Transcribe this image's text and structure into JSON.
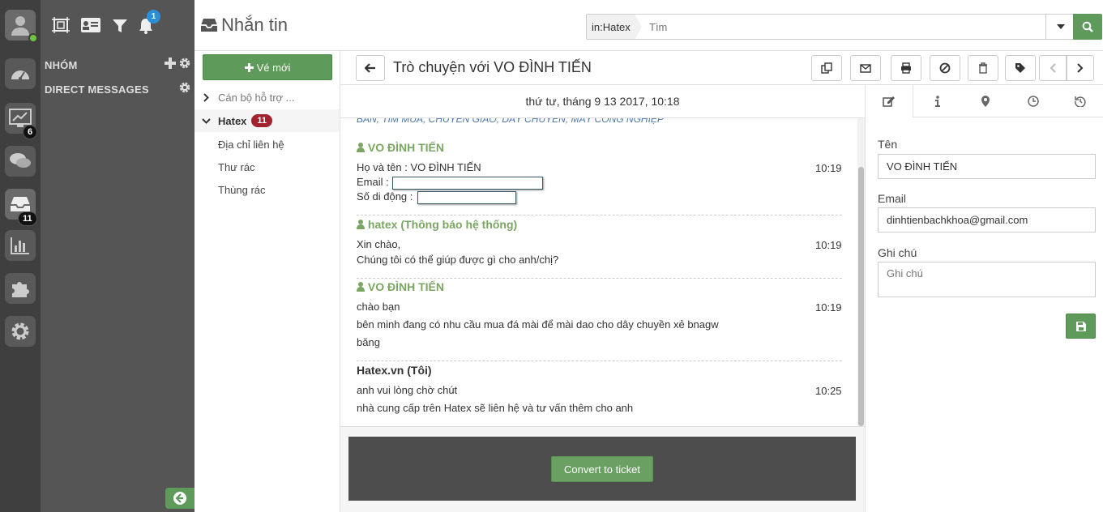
{
  "rail": {
    "badges": {
      "activity": "6",
      "inbox": "11"
    }
  },
  "sidebar": {
    "notification_count": "1",
    "groups_label": "NHÓM",
    "dm_label": "DIRECT MESSAGES"
  },
  "header": {
    "title": "Nhắn tin",
    "search_scope": "in:Hatex",
    "search_placeholder": "Tìm"
  },
  "folders": {
    "new_ticket_label": "Vé mới",
    "items": [
      {
        "label": "Cán bộ hỗ trợ ..."
      },
      {
        "label": "Hatex",
        "count": "11"
      },
      {
        "label": "Địa chỉ liên hệ"
      },
      {
        "label": "Thư rác"
      },
      {
        "label": "Thùng rác"
      }
    ]
  },
  "conversation": {
    "title": "Trò chuyện với VO ĐÌNH TIẾN",
    "date": "thứ tư, tháng 9 13 2017, 10:18",
    "cut_text": "BÁN, TÌM MUA, CHUYỂN GIAO, DÂY CHUYỀN, MÁY CÔNG NGHIỆP",
    "messages": [
      {
        "author": "VO ĐÌNH TIẾN",
        "time": "10:19",
        "lines": [
          "Họ và tên : VO ĐÌNH TIẾN",
          "Email :",
          "Số di động :"
        ]
      },
      {
        "author": "hatex (Thông báo hệ thống)",
        "time": "10:19",
        "lines": [
          "Xin chào,",
          "Chúng tôi có thể giúp được gì cho anh/chị?"
        ]
      },
      {
        "author": "VO ĐÌNH TIẾN",
        "time": "10:19",
        "lines": [
          "chào bạn",
          "bên minh đang có nhu cầu mua đá mài để mài dao cho dây chuyền xẻ bnagw",
          "băng"
        ]
      },
      {
        "author": "Hatex.vn (Tôi)",
        "time": "10:25",
        "lines": [
          "anh vui lòng chờ chút",
          "nhà cung cấp trên Hatex sẽ liên hệ và tư vấn thêm cho anh"
        ]
      }
    ],
    "convert_label": "Convert to ticket"
  },
  "panel": {
    "name_label": "Tên",
    "name_value": "VO ĐÌNH TIẾN",
    "email_label": "Email",
    "email_value": "dinhtienbachkhoa@gmail.com",
    "note_label": "Ghi chú",
    "note_placeholder": "Ghi chú"
  },
  "colors": {
    "accent_green": "#5e9a5a",
    "author_green": "#7aa663",
    "badge_red": "#a3222f",
    "badge_blue": "#2c8fd6",
    "rail_bg": "#3f3f3f",
    "sidebar_bg": "#555555"
  }
}
